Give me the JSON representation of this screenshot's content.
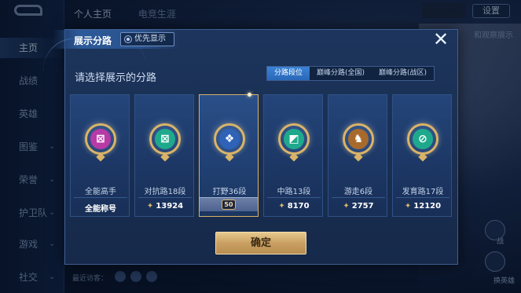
{
  "background": {
    "top_tabs": [
      "个人主页",
      "电竞生涯"
    ],
    "settings_label": "设置",
    "side_toggle_label": "和观察展示",
    "nav_items": [
      {
        "label": "主页",
        "active": true
      },
      {
        "label": "战绩",
        "active": false
      },
      {
        "label": "英雄",
        "active": false
      },
      {
        "label": "图鉴",
        "active": false
      },
      {
        "label": "荣誉",
        "active": false
      },
      {
        "label": "护卫队",
        "active": false
      },
      {
        "label": "游戏",
        "active": false
      },
      {
        "label": "社交",
        "active": false
      }
    ],
    "bottom_text": "最近访客：",
    "right_widgets": [
      "战",
      "换英雄"
    ]
  },
  "modal": {
    "title": "展示分路",
    "priority_toggle_label": "优先显示",
    "close_glyph": "✕",
    "prompt": "请选择展示的分路",
    "filters": [
      {
        "label": "分路段位",
        "active": true
      },
      {
        "label": "巅峰分路(全国)",
        "active": false
      },
      {
        "label": "巅峰分路(战区)",
        "active": false
      }
    ],
    "cards": [
      {
        "label": "全能高手",
        "score": "全能称号",
        "has_star": false,
        "icon": "allround-icon",
        "color": "#b73aa6",
        "symbol": "⊠"
      },
      {
        "label": "对抗路18段",
        "score": "13924",
        "has_star": true,
        "icon": "clash-lane-icon",
        "color": "#1fa98c",
        "symbol": "⊠"
      },
      {
        "label": "打野36段",
        "score": "",
        "has_star": false,
        "icon": "jungle-icon",
        "color": "#2f63b8",
        "symbol": "❖",
        "selected": true,
        "chip": "50"
      },
      {
        "label": "中路13段",
        "score": "8170",
        "has_star": true,
        "icon": "mid-lane-icon",
        "color": "#1fa98c",
        "symbol": "◩"
      },
      {
        "label": "游走6段",
        "score": "2757",
        "has_star": true,
        "icon": "roam-icon",
        "color": "#a86a2c",
        "symbol": "♞"
      },
      {
        "label": "发育路17段",
        "score": "12120",
        "has_star": true,
        "icon": "farm-lane-icon",
        "color": "#1fa98c",
        "symbol": "⊘"
      }
    ],
    "confirm_label": "确定"
  }
}
